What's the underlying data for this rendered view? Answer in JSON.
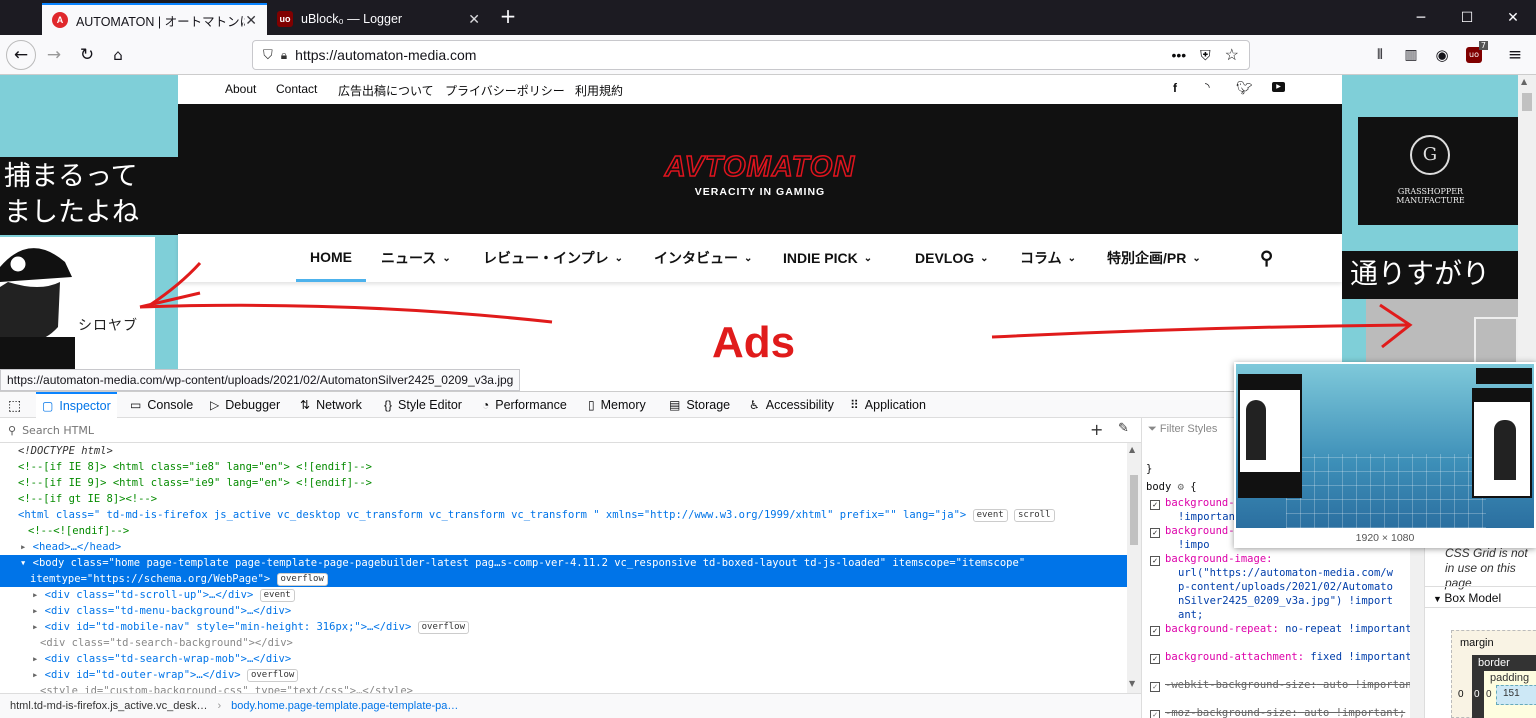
{
  "browser": {
    "tabs": [
      {
        "title": "AUTOMATON | オートマトンは日本",
        "active": true
      },
      {
        "title": "uBlock₀ — Logger",
        "active": false
      }
    ],
    "new_tab": "+",
    "url": "https://automaton-media.com",
    "ublock_count": "7",
    "win_min": "─",
    "win_max": "☐",
    "win_close": "✕"
  },
  "site": {
    "top_menu": [
      "About",
      "Contact",
      "広告出稿について",
      "プライバシーポリシー",
      "利用規約"
    ],
    "logo": "AVTOMATON",
    "tagline": "VERACITY IN GAMING",
    "nav": [
      "HOME",
      "ニュース",
      "レビュー・インプレ",
      "インタビュー",
      "INDIE PICK",
      "DEVLOG",
      "コラム",
      "特別企画/PR"
    ],
    "ad_left_text": "捕まるって\nましたよね",
    "ad_left_small": "シロヤブ",
    "ad_right_text": "通りすがり",
    "ad_right_logo": "GRASSHOPPER\nMANUFACTURE",
    "annotation": "Ads"
  },
  "status_url": "https://automaton-media.com/wp-content/uploads/2021/02/AutomatonSilver2425_0209_v3a.jpg",
  "devtools": {
    "tabs": [
      "Inspector",
      "Console",
      "Debugger",
      "Network",
      "Style Editor",
      "Performance",
      "Memory",
      "Storage",
      "Accessibility",
      "Application"
    ],
    "search_placeholder": "Search HTML",
    "filter_placeholder": "Filter Styles",
    "markup": [
      "<!DOCTYPE html>",
      "<!--[if IE 8]> <html class=\"ie8\" lang=\"en\"> <![endif]-->",
      "<!--[if IE 9]> <html class=\"ie9\" lang=\"en\"> <![endif]-->",
      "<!--[if gt IE 8]><!-->",
      "<html class=\" td-md-is-firefox js_active vc_desktop vc_transform vc_transform vc_transform \" xmlns=\"http://www.w3.org/1999/xhtml\" prefix=\"\" lang=\"ja\">",
      "<!--<![endif]-->",
      "<head>…</head>",
      "<body class=\"home page-template page-template-page-pagebuilder-latest pag…s-comp-ver-4.11.2 vc_responsive td-boxed-layout td-js-loaded\" itemscope=\"itemscope\"",
      "itemtype=\"https://schema.org/WebPage\">",
      "<div class=\"td-scroll-up\">…</div>",
      "<div class=\"td-menu-background\">…</div>",
      "<div id=\"td-mobile-nav\" style=\"min-height: 316px;\">…</div>",
      "<div class=\"td-search-background\"></div>",
      "<div class=\"td-search-wrap-mob\">…</div>",
      "<div id=\"td-outer-wrap\">…</div>",
      "<style id=\"custom-background-css\" type=\"text/css\">…</style>"
    ],
    "badges": {
      "event": "event",
      "scroll": "scroll",
      "overflow": "overflow"
    },
    "breadcrumbs": [
      "html.td-md-is-firefox.js_active.vc_desk…",
      "body.home.page-template.page-template-pa…"
    ],
    "rules": {
      "selector": "body",
      "items": [
        {
          "prop": "background-",
          "val": "!important;"
        },
        {
          "prop": "background-",
          "val": "!impo"
        },
        {
          "prop": "background-image:",
          "val": "url(\"https://automaton-media.com/wp-content/uploads/2021/02/AutomatonSilver2425_0209_v3a.jpg\") !important;"
        },
        {
          "prop": "background-repeat:",
          "val": "no-repeat !important;"
        },
        {
          "prop": "background-attachment:",
          "val": "fixed !important;"
        },
        {
          "prop": "-webkit-background-size:",
          "val": "auto !important;"
        },
        {
          "prop": "-moz-background-size:",
          "val": "auto !important;"
        }
      ]
    },
    "layout": {
      "grid_note": "CSS Grid is not in use on this page",
      "box_model": "Box Model",
      "margin": "margin",
      "border": "border",
      "padding": "padding",
      "zero": "0",
      "width_partial": "151"
    },
    "preview_size": "1920 × 1080"
  }
}
